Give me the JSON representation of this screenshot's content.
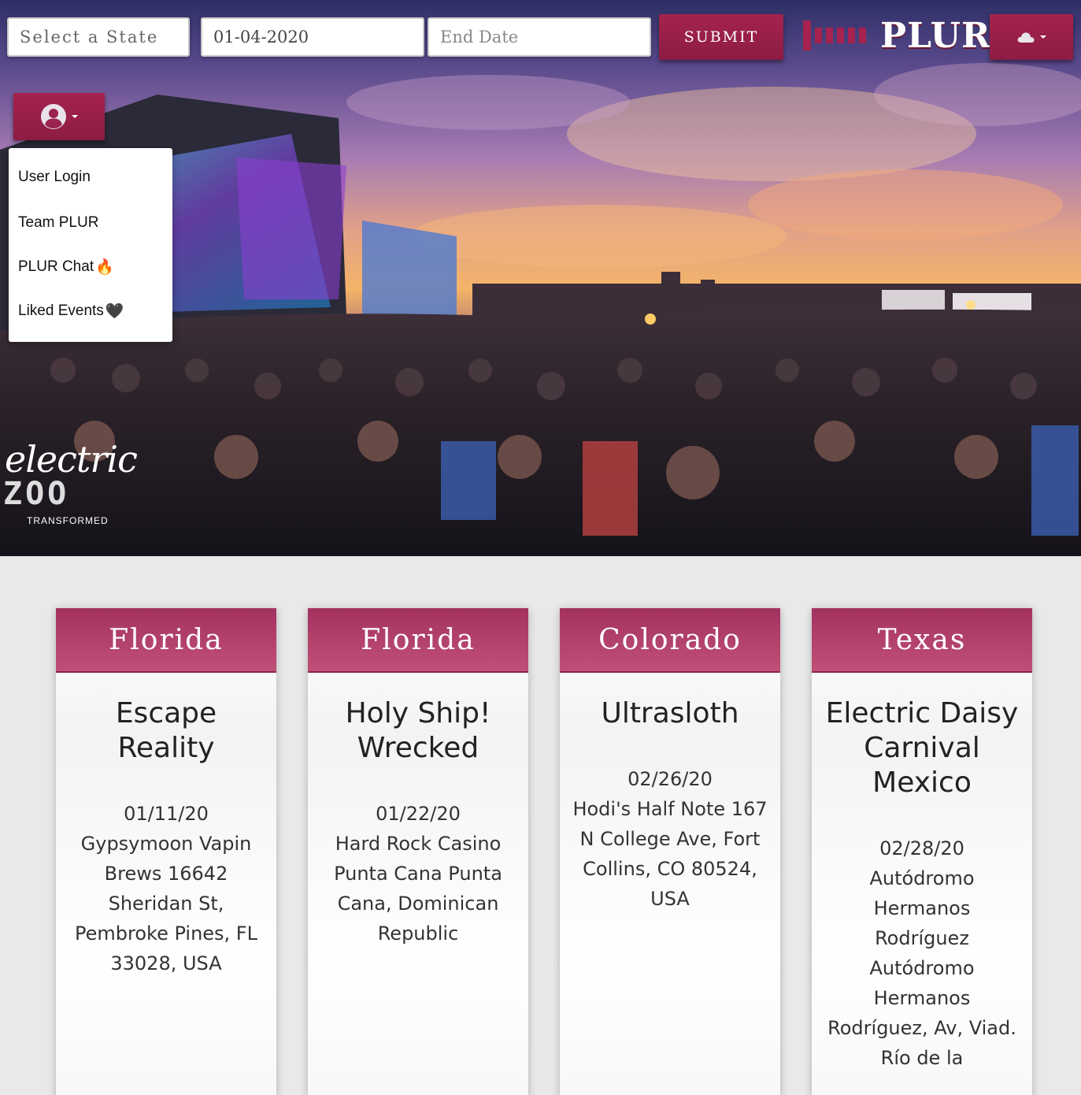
{
  "header": {
    "state_select": {
      "placeholder": "Select a State"
    },
    "start_date": {
      "value": "01-04-2020"
    },
    "end_date": {
      "placeholder": "End Date"
    },
    "submit_label": "SUBMIT",
    "logo_text": "PLUR",
    "weather_icon": "cloud-icon"
  },
  "user_menu": {
    "icon": "user-circle-icon",
    "items": [
      {
        "label": "User Login"
      },
      {
        "label": "Team PLUR"
      },
      {
        "label": "PLUR Chat",
        "emoji": "🔥"
      },
      {
        "label": "Liked Events",
        "emoji": "🖤"
      }
    ]
  },
  "hero": {
    "watermark_script": "electric",
    "watermark_main": "ZOO",
    "watermark_sub": "TRANSFORMED"
  },
  "events": [
    {
      "state": "Florida",
      "name": "Escape Reality",
      "date": "01/11/20",
      "venue": "Gypsymoon Vapin Brews 16642 Sheridan St, Pembroke Pines, FL 33028, USA"
    },
    {
      "state": "Florida",
      "name": "Holy Ship! Wrecked",
      "date": "01/22/20",
      "venue": "Hard Rock Casino Punta Cana Punta Cana, Dominican Republic"
    },
    {
      "state": "Colorado",
      "name": "Ultrasloth",
      "date": "02/26/20",
      "venue": "Hodi's Half Note 167 N College Ave, Fort Collins, CO 80524, USA"
    },
    {
      "state": "Texas",
      "name": "Electric Daisy Carnival Mexico",
      "date": "02/28/20",
      "venue": "Autódromo Hermanos Rodríguez Autódromo Hermanos Rodríguez, Av, Viad. Río de la"
    }
  ],
  "colors": {
    "accent": "#a5234e",
    "card_header": "#b0406a",
    "page_bg": "#e9e9e9"
  }
}
